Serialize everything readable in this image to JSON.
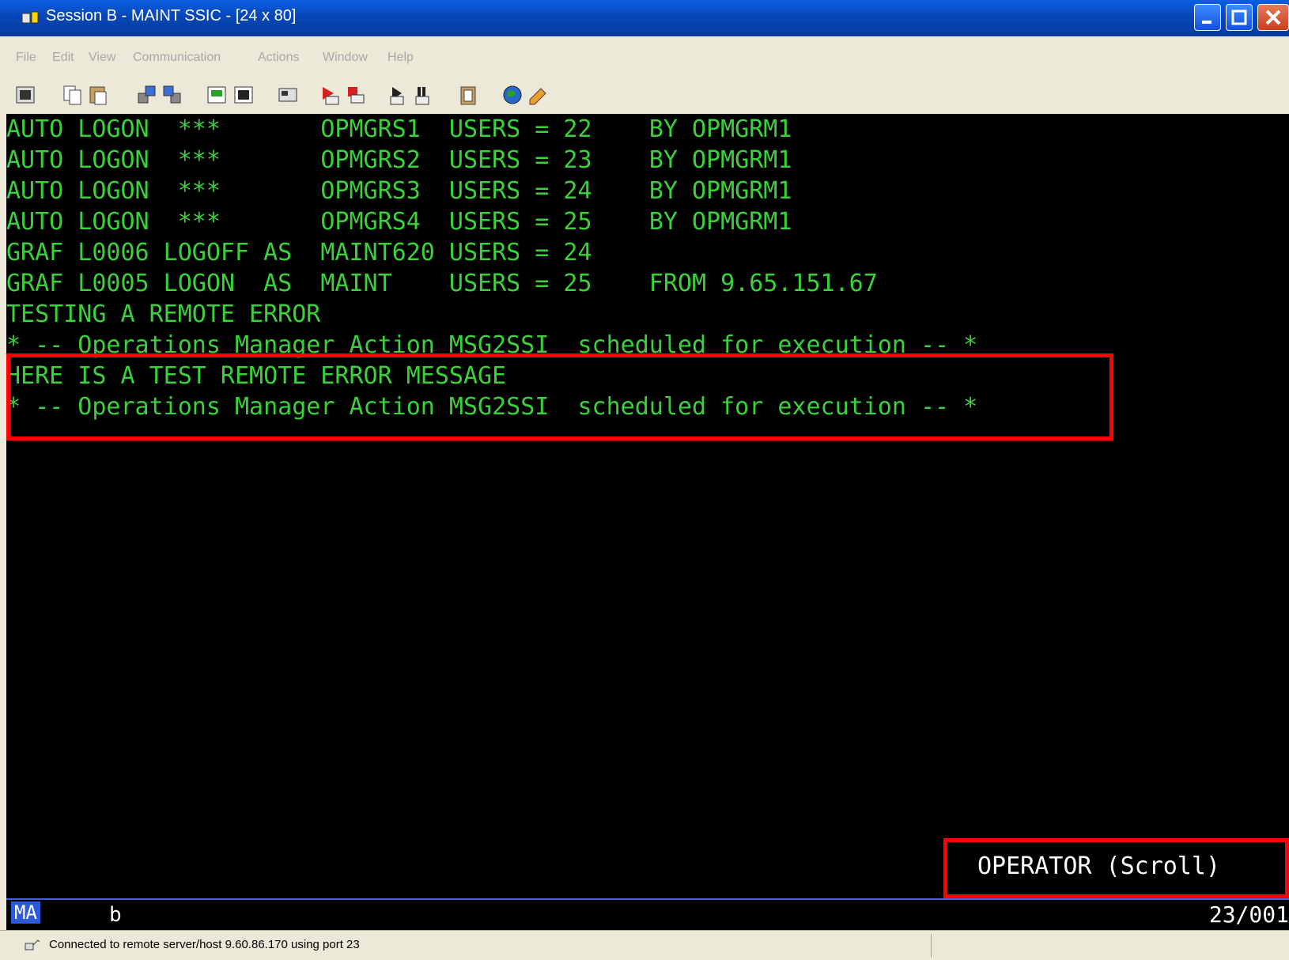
{
  "window": {
    "title": "Session B - MAINT SSIC - [24 x 80]",
    "icons": [
      "app-icon",
      "minimize-icon",
      "maximize-icon",
      "close-icon"
    ]
  },
  "menu": [
    "File",
    "Edit",
    "View",
    "Communication",
    "Actions",
    "Window",
    "Help"
  ],
  "toolbar": {
    "buttons": [
      "print-screen-icon",
      "copy-icon",
      "paste-icon",
      "send-icon",
      "receive-icon",
      "display-icon",
      "keypad-icon",
      "macro-icon",
      "record-macro-icon",
      "stop-macro-icon",
      "play-macro-icon",
      "pause-macro-icon",
      "clipboard-icon",
      "globe-icon",
      "edit-icon"
    ]
  },
  "terminal": {
    "lines": [
      "AUTO LOGON  ***       OPMGRS1  USERS = 22    BY OPMGRM1",
      "AUTO LOGON  ***       OPMGRS2  USERS = 23    BY OPMGRM1",
      "AUTO LOGON  ***       OPMGRS3  USERS = 24    BY OPMGRM1",
      "AUTO LOGON  ***       OPMGRS4  USERS = 25    BY OPMGRM1",
      "GRAF L0006 LOGOFF AS  MAINT620 USERS = 24",
      "GRAF L0005 LOGON  AS  MAINT    USERS = 25    FROM 9.65.151.67",
      "TESTING A REMOTE ERROR",
      "* -- Operations Manager Action MSG2SSI  scheduled for execution -- *",
      "HERE IS A TEST REMOTE ERROR MESSAGE",
      "* -- Operations Manager Action MSG2SSI  scheduled for execution -- *"
    ],
    "mode_status": "OPERATOR (Scroll)",
    "text_color": "#3bd13b",
    "highlight_color": "#ff0000"
  },
  "oia": {
    "session_indicator": "MA",
    "session_letter": "b",
    "cursor_position": "23/001"
  },
  "statusbar": {
    "message": "Connected to remote server/host 9.60.86.170 using port 23"
  }
}
